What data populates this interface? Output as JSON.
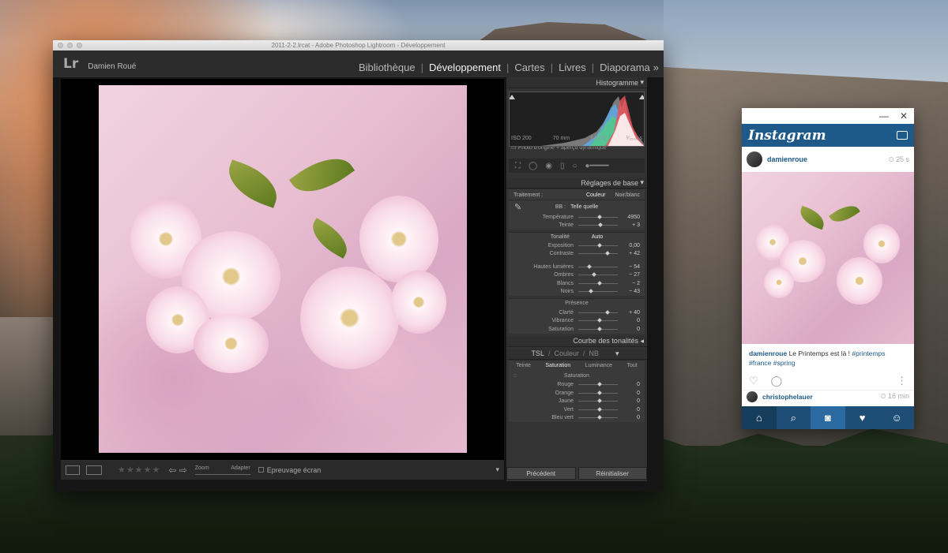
{
  "lightroom": {
    "window_title": "2011-2-2.lrcat - Adobe Photoshop Lightroom - Développement",
    "logo": "Lr",
    "user_name": "Damien Roué",
    "modules": [
      {
        "label": "Bibliothèque"
      },
      {
        "label": "Développement"
      },
      {
        "label": "Cartes"
      },
      {
        "label": "Livres"
      },
      {
        "label": "Diaporama"
      }
    ],
    "modules_more": "»",
    "panel_histogram": "Histogramme",
    "histo_info": {
      "iso": "ISO 200",
      "focal": "70 mm",
      "aperture": "f / 2,8",
      "shutter": "¹⁄₂₅₀₀ s"
    },
    "histo_sub": "Photo d'origine + aperçu dynamique",
    "panel_basic": "Réglages de base",
    "treatment_label": "Traitement :",
    "treatment_color": "Couleur",
    "treatment_bw": "Noir/blanc",
    "wb_label": "BB :",
    "wb_value": "Telle quelle",
    "temp_sliders": [
      {
        "label": "Température",
        "value": "4950",
        "pos": 0.5
      },
      {
        "label": "Teinte",
        "value": "+ 3",
        "pos": 0.52
      }
    ],
    "tonality_label": "Tonalité",
    "auto_label": "Auto",
    "tone_sliders": [
      {
        "label": "Exposition",
        "value": "0,00",
        "pos": 0.5
      },
      {
        "label": "Contraste",
        "value": "+ 42",
        "pos": 0.7
      }
    ],
    "tone_sliders2": [
      {
        "label": "Hautes lumières",
        "value": "− 54",
        "pos": 0.23
      },
      {
        "label": "Ombres",
        "value": "− 27",
        "pos": 0.36
      },
      {
        "label": "Blancs",
        "value": "− 2",
        "pos": 0.49
      },
      {
        "label": "Noirs",
        "value": "− 43",
        "pos": 0.28
      }
    ],
    "presence_label": "Présence",
    "presence_sliders": [
      {
        "label": "Clarté",
        "value": "+ 40",
        "pos": 0.7
      },
      {
        "label": "Vibrance",
        "value": "0",
        "pos": 0.5
      },
      {
        "label": "Saturation",
        "value": "0",
        "pos": 0.5
      }
    ],
    "panel_curve": "Courbe des tonalités",
    "panel_hsl": {
      "tsl": "TSL",
      "color": "Couleur",
      "nb": "NB",
      "sep": "/"
    },
    "hsl_tabs": [
      "Teinte",
      "Saturation",
      "Luminance",
      "Tout"
    ],
    "saturation_label": "Saturation",
    "hsl_sliders": [
      {
        "label": "Rouge",
        "value": "0",
        "pos": 0.5
      },
      {
        "label": "Orange",
        "value": "0",
        "pos": 0.5
      },
      {
        "label": "Jaune",
        "value": "0",
        "pos": 0.5
      },
      {
        "label": "Vert",
        "value": "0",
        "pos": 0.5
      },
      {
        "label": "Bleu vert",
        "value": "0",
        "pos": 0.5
      }
    ],
    "btn_previous": "Précédent",
    "btn_reset": "Réinitialiser",
    "filmstrip": {
      "zoom": "Zoom",
      "fit": "Adapter",
      "softproof": "Epreuvage écran",
      "stars": "★★★★★",
      "arrows": "⇦ ⇨"
    }
  },
  "instagram": {
    "logo": "Instagram",
    "close": "✕",
    "minimize": "—",
    "post_user": "damienroue",
    "post_time": "25 s",
    "caption_user": "damienroue",
    "caption_text": "Le Printemps est là !",
    "hashtags": [
      "#printemps",
      "#france",
      "#spring"
    ],
    "next_user": "christophelauer",
    "next_time": "16 min"
  }
}
